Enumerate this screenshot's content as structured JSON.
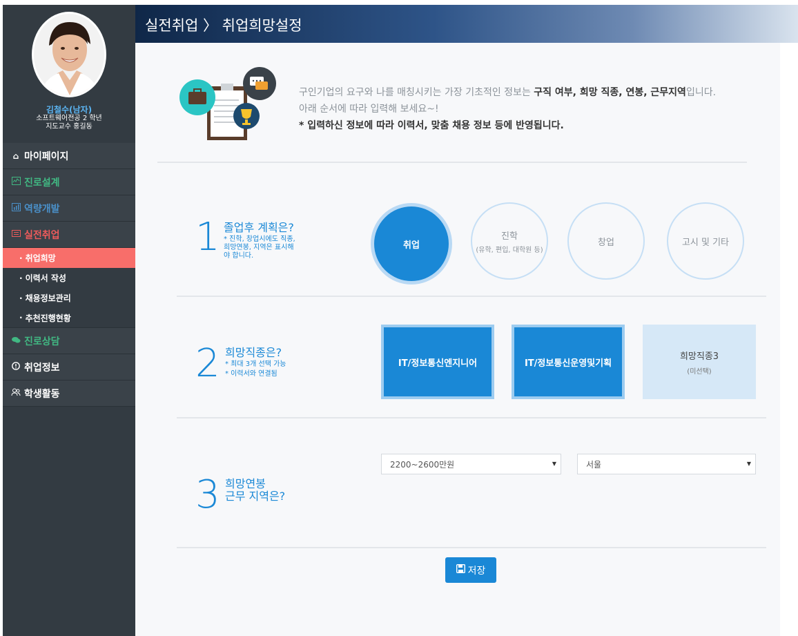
{
  "header": {
    "breadcrumb": "실전취업 〉 취업희망설정"
  },
  "profile": {
    "name": "김철수(남자)",
    "major": "소프트웨어전공 2 학년",
    "advisor": "지도교수 홍길동"
  },
  "nav": {
    "mypage": {
      "label": "마이페이지",
      "icon": "home-icon",
      "color": "#ffffff"
    },
    "career_design": {
      "label": "진로설계",
      "icon": "chart-icon",
      "color": "#41b883"
    },
    "competency": {
      "label": "역량개발",
      "icon": "bar-chart-icon",
      "color": "#4a90c9"
    },
    "practical": {
      "label": "실전취업",
      "icon": "list-icon",
      "color": "#ee5b5b"
    },
    "sub": [
      {
        "label": "취업희망",
        "active": true
      },
      {
        "label": "이력서 작성",
        "active": false
      },
      {
        "label": "채용정보관리",
        "active": false
      },
      {
        "label": "추천진행현황",
        "active": false
      }
    ],
    "counsel": {
      "label": "진로상담",
      "icon": "chat-icon",
      "color": "#41b883"
    },
    "job_info": {
      "label": "취업정보",
      "icon": "info-icon",
      "color": "#ffffff"
    },
    "student": {
      "label": "학생활동",
      "icon": "users-icon",
      "color": "#ffffff"
    }
  },
  "intro": {
    "line1_pre": "구인기업의 요구와 나를 매칭시키는 가장 기초적인 정보는 ",
    "line1_bold": "구직 여부, 희망 직종, 연봉, 근무지역",
    "line1_post": "입니다.",
    "line2": "아래 순서에 따라 입력해 보세요~!",
    "note": "* 입력하신 정보에 따라 이력서, 맞춤 채용 정보 등에 반영됩니다."
  },
  "step1": {
    "num": "1",
    "title": "졸업후 계획은?",
    "note": "* 진학, 창업시에도 직종,\n희망연봉, 지역은 표시해\n야 합니다.",
    "options": [
      {
        "label": "취업",
        "sub": "",
        "active": true
      },
      {
        "label": "진학",
        "sub": "(유학, 편입, 대학원 등)",
        "active": false
      },
      {
        "label": "창업",
        "sub": "",
        "active": false
      },
      {
        "label": "고시 및 기타",
        "sub": "",
        "active": false
      }
    ]
  },
  "step2": {
    "num": "2",
    "title": "희망직종은?",
    "note1": "* 최대 3개 선택 가능",
    "note2": "* 이력서와 연결됨",
    "jobs": [
      {
        "label": "IT/정보통신엔지니어",
        "sub": "",
        "selected": true
      },
      {
        "label": "IT/정보통신운영및기획",
        "sub": "",
        "selected": true
      },
      {
        "label": "희망직종3",
        "sub": "(미선택)",
        "selected": false
      }
    ]
  },
  "step3": {
    "num": "3",
    "title1": "희망연봉",
    "title2": "근무 지역은?",
    "salary": "2200~2600만원",
    "region": "서울"
  },
  "save_label": "저장",
  "colors": {
    "accent": "#1a88d6",
    "active_sub": "#f86e6a",
    "sidebar": "#333b42"
  }
}
